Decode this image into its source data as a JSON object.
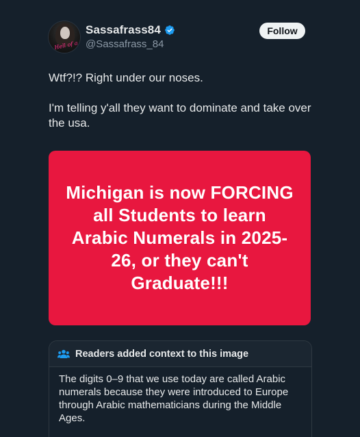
{
  "author": {
    "display_name": "Sassafrass84",
    "handle": "@Sassafrass_84",
    "verified": true,
    "avatar_icon": "profile-photo",
    "avatar_script": "Hell of a Sassy Sassy"
  },
  "actions": {
    "follow_label": "Follow"
  },
  "tweet": {
    "line1": "Wtf?!? Right under our noses.",
    "line2": "I'm telling y'all they want to dominate and take over the usa."
  },
  "media": {
    "background_color": "#e8173f",
    "text": "Michigan is now FORCING all Students to learn Arabic Numerals in 2025-26, or they can't Graduate!!!"
  },
  "community_note": {
    "icon": "people-icon",
    "title": "Readers added context to this image",
    "body": "The digits 0–9 that we use today are called Arabic numerals because they were introduced to Europe through Arabic mathematicians during the Middle Ages."
  },
  "colors": {
    "background": "#15202b",
    "verified_blue": "#1d9bf0",
    "note_icon": "#1d9bf0"
  }
}
